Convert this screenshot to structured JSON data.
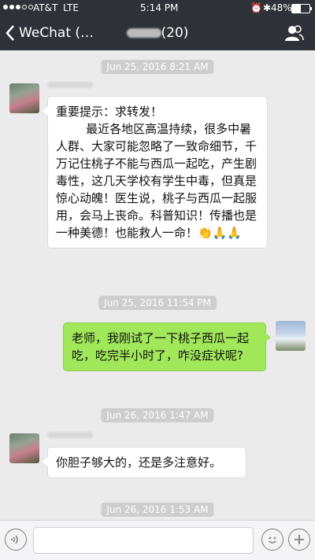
{
  "status_bar": {
    "carrier": "AT&T",
    "network": "LTE",
    "time": "5:14 PM",
    "battery_percent": "48%",
    "battery_level": 0.48
  },
  "nav": {
    "back_label": "WeChat (…",
    "title_count": "(20)"
  },
  "messages": {
    "t1": "Jun 25, 2016 8:21 AM",
    "m1": "重要提示：求转发！\n        最近各地区高温持续，很多中暑人群、大家可能忽略了一致命细节，千万记住桃子不能与西瓜一起吃，产生剧毒性，这几天学校有学生中毒，但真是惊心动魄！医生说，桃子与西瓜一起服用，会马上丧命。科普知识！传播也是一种美德！也能救人一命！👏🙏🙏",
    "t2": "Jun 25, 2016 11:54 PM",
    "m2": "老师，我刚试了一下桃子西瓜一起吃，吃完半小时了，咋没症状呢?",
    "t3": "Jun 26, 2016 1:47 AM",
    "m3": "你胆子够大的，还是多注意好。",
    "t4": "Jun 26, 2016 1:53 AM"
  },
  "input": {
    "value": ""
  },
  "icons": {
    "back": "chevron-left-icon",
    "contacts": "contacts-icon",
    "voice": "voice-icon",
    "emoji": "emoji-icon",
    "add": "plus-icon"
  }
}
